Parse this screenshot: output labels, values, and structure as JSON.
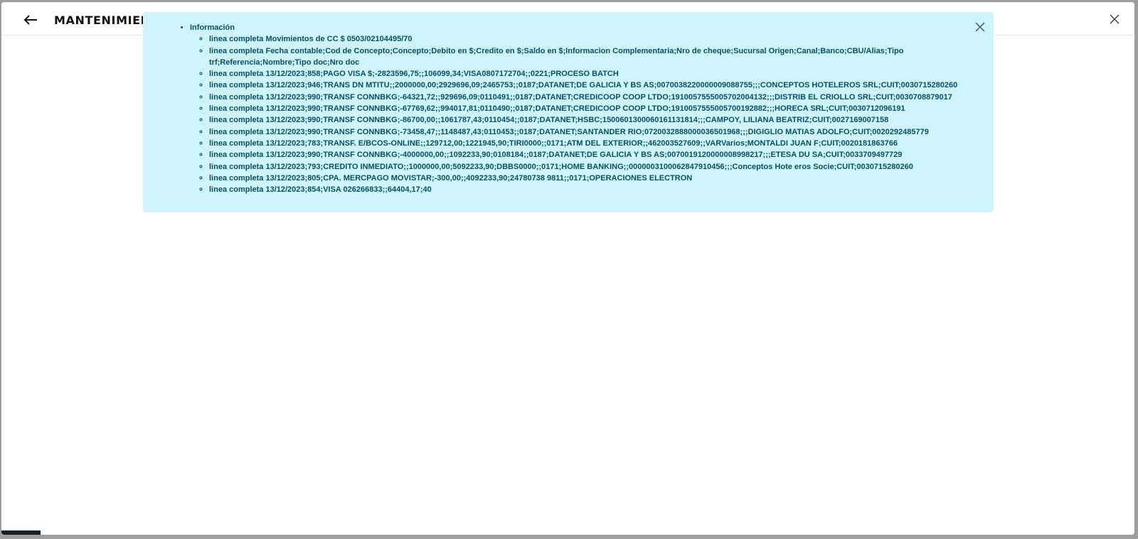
{
  "header": {
    "title": "MANTENIMIENTO",
    "back_icon": "arrow-left-icon",
    "close_icon": "close-icon"
  },
  "alert": {
    "heading": "Información",
    "close_icon": "close-icon",
    "background": "#cff4fc",
    "text_color": "#055160",
    "lines": [
      "linea completa Movimientos de CC $ 0503/02104495/70",
      "linea completa Fecha contable;Cod de Concepto;Concepto;Debito en $;Credito en $;Saldo en $;Informacion Complementaria;Nro de cheque;Sucursal Origen;Canal;Banco;CBU/Alias;Tipo trf;Referencia;Nombre;Tipo doc;Nro doc",
      "linea completa 13/12/2023;858;PAGO VISA $;-2823596,75;;106099,34;VISA0807172704;;0221;PROCESO BATCH",
      "linea completa 13/12/2023;946;TRANS DN MTITU;;2000000,00;2929696,09;2465753;;0187;DATANET;DE GALICIA Y BS AS;0070038220000009088755;;;CONCEPTOS HOTELEROS SRL;CUIT;0030715280260",
      "linea completa 13/12/2023;990;TRANSF CONNBKG;-64321,72;;929696,09;0110491;;0187;DATANET;CREDICOOP COOP LTDO;1910057555005702004132;;;DISTRIB EL CRIOLLO SRL;CUIT;0030708879017",
      "linea completa 13/12/2023;990;TRANSF CONNBKG;-67769,62;;994017,81;0110490;;0187;DATANET;CREDICOOP COOP LTDO;1910057555005700192882;;;HORECA SRL;CUIT;0030712096191",
      "linea completa 13/12/2023;990;TRANSF CONNBKG;-86700,00;;1061787,43;0110454;;0187;DATANET;HSBC;1500601300060161131814;;;CAMPOY, LILIANA BEATRIZ;CUIT;0027169007158",
      "linea completa 13/12/2023;990;TRANSF CONNBKG;-73458,47;;1148487,43;0110453;;0187;DATANET;SANTANDER RIO;0720032888000036501968;;;DIGIGLIO MATIAS ADOLFO;CUIT;0020292485779",
      "linea completa 13/12/2023;783;TRANSF. E/BCOS-ONLINE;;129712,00;1221945,90;TIRI0000;;0171;ATM DEL EXTERIOR;;462003527609;;VARVarios;MONTALDI JUAN F;CUIT;0020181863766",
      "linea completa 13/12/2023;990;TRANSF CONNBKG;-4000000,00;;1092233,90;0108184;;0187;DATANET;DE GALICIA Y BS AS;0070019120000008998217;;;ETESA DU SA;CUIT;0033709497729",
      "linea completa 13/12/2023;793;CREDITO INMEDIATO;;1000000,00;5092233,90;DBBS0000;;0171;HOME BANKING;;0000003100062847910456;;;Conceptos Hote eros Socie;CUIT;0030715280260",
      "linea completa 13/12/2023;805;CPA. MERCPAGO MOVISTAR;-300,00;;4092233,90;24780738 9811;;0171;OPERACIONES ELECTRON",
      "linea completa 13/12/2023;854;VISA 026266833;;64404,17;40"
    ]
  }
}
